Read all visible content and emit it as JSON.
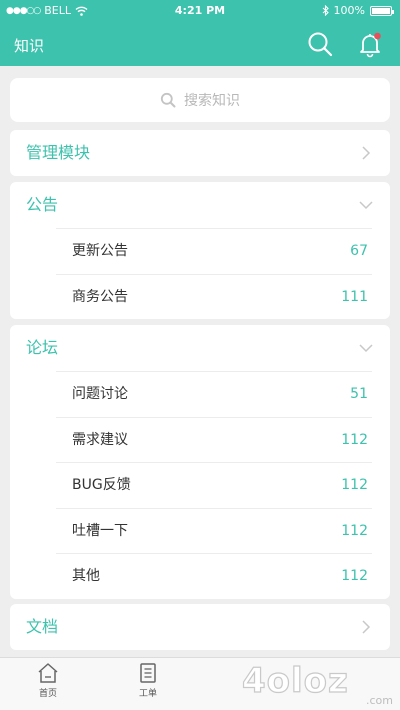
{
  "status_bar": {
    "carrier": "BELL",
    "time": "4:21 PM",
    "battery": "100%"
  },
  "nav": {
    "title": "知识"
  },
  "search": {
    "placeholder": "搜索知识"
  },
  "sections": {
    "management": {
      "title": "管理模块"
    },
    "announcements": {
      "title": "公告",
      "items": [
        {
          "label": "更新公告",
          "count": "67"
        },
        {
          "label": "商务公告",
          "count": "111"
        }
      ]
    },
    "forum": {
      "title": "论坛",
      "items": [
        {
          "label": "问题讨论",
          "count": "51"
        },
        {
          "label": "需求建议",
          "count": "112"
        },
        {
          "label": "BUG反馈",
          "count": "112"
        },
        {
          "label": "吐槽一下",
          "count": "112"
        },
        {
          "label": "其他",
          "count": "112"
        }
      ]
    },
    "docs": {
      "title": "文档"
    }
  },
  "tabbar": {
    "items": [
      {
        "label": "首页",
        "icon": "home-icon"
      },
      {
        "label": "工单",
        "icon": "clipboard-icon"
      }
    ]
  },
  "watermark": {
    "text": "4oloz",
    "suffix": ".com"
  },
  "colors": {
    "accent": "#3dc2ad",
    "notification_dot": "#e8505b",
    "background": "#eeeeee"
  }
}
